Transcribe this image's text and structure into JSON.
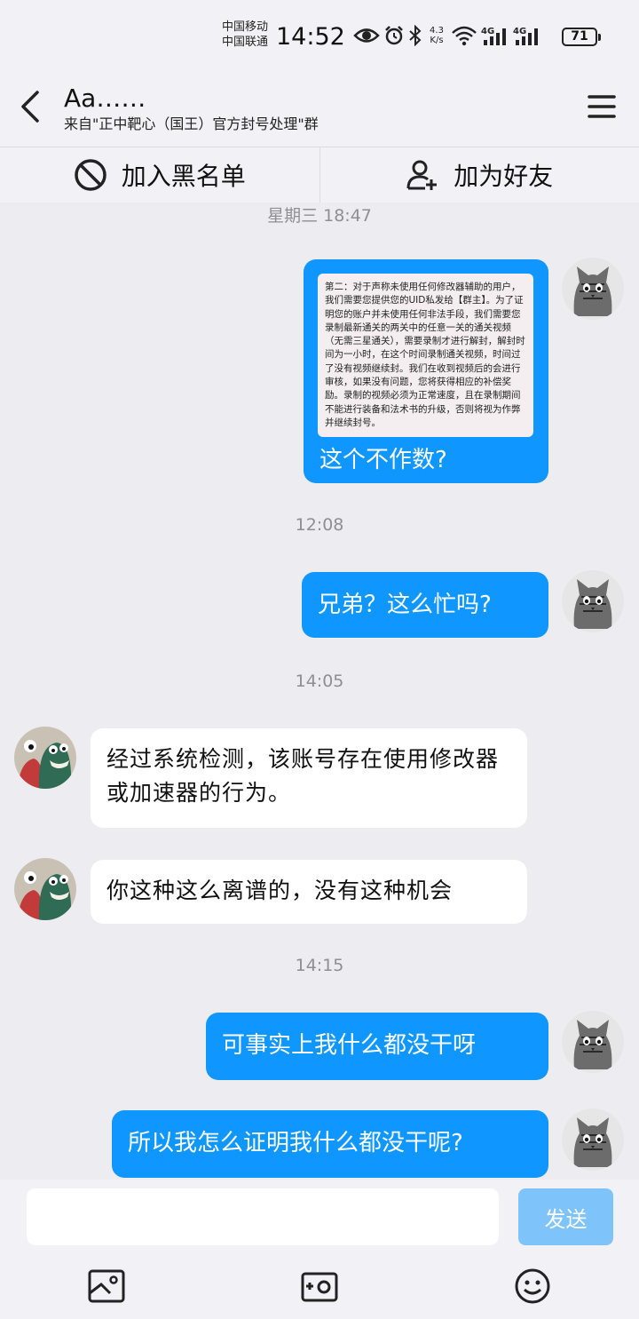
{
  "status_bar": {
    "carrier1": "中国移动",
    "carrier2": "中国联通",
    "time": "14:52",
    "net_speed_value": "4.3",
    "net_speed_unit": "K/s",
    "signal1": "4G",
    "signal2": "4G",
    "battery": "71"
  },
  "header": {
    "title": "Aa……",
    "subtitle": "来自\"正中靶心（国王）官方封号处理\"群"
  },
  "actions": {
    "blacklist_label": "加入黑名单",
    "add_friend_label": "加为好友"
  },
  "messages": {
    "time1": "星期三 18:47",
    "image_text": "第二：对于声称未使用任何修改器辅助的用户，我们需要您提供您的UID私发给【群主】。为了证明您的账户并未使用任何非法手段，我们需要您录制最新通关的两关中的任意一关的通关视频（无需三星通关），需要录制才进行解封，解封时间为一小时，在这个时间录制通关视频，时间过了没有视频继续封。我们在收到视频后的会进行审核，如果没有问题，您将获得相应的补偿奖励。录制的视频必须为正常速度，且在录制期间不能进行装备和法术书的升级，否则将视为作弊并继续封号。",
    "image_caption": "这个不作数?",
    "time2": "12:08",
    "msg2": "兄弟？这么忙吗?",
    "time3": "14:05",
    "reply1": "经过系统检测，该账号存在使用修改器或加速器的行为。",
    "reply2": "你这种这么离谱的，没有这种机会",
    "time4": "14:15",
    "msg3": "可事实上我什么都没干呀",
    "msg4": "所以我怎么证明我什么都没干呢?"
  },
  "input": {
    "placeholder": "",
    "send_label": "发送"
  },
  "colors": {
    "my_bubble": "#0f97ff",
    "their_bubble": "#ffffff",
    "send_disabled": "#7ec4fb",
    "background": "#ececf1"
  }
}
